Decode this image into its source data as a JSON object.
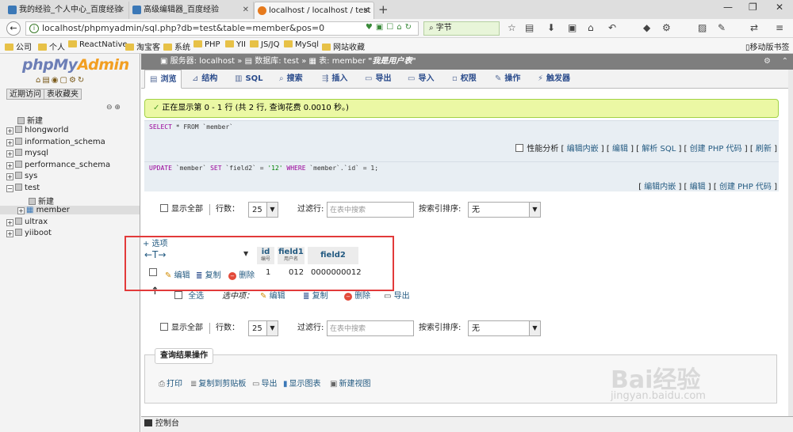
{
  "browser": {
    "tabs": [
      {
        "label": "我的经验_个人中心_百度经验"
      },
      {
        "label": "高级编辑器_百度经验"
      },
      {
        "label": "localhost / localhost / test"
      }
    ],
    "new_tab": "+",
    "url": "localhost/phpmyadmin/sql.php?db=test&table=member&pos=0",
    "search_text": "字节",
    "bookmarks": [
      "公司",
      "个人",
      "ReactNative",
      "淘宝客",
      "系统",
      "PHP",
      "YII",
      "JS/JQ",
      "MySql",
      "网站收藏"
    ],
    "mobile_bookmarks": "移动版书签"
  },
  "nav": {
    "logo_main": "phpMy",
    "logo_accent": "Admin",
    "recent_button": "近期访问",
    "favorites_button": "表收藏夹",
    "collapse": "⊖ ⊕",
    "tree": {
      "new1": "新建",
      "db1": "hlongworld",
      "db2": "information_schema",
      "db3": "mysql",
      "db4": "performance_schema",
      "db5": "sys",
      "db6": "test",
      "new2": "新建",
      "table": "member",
      "db7": "ultrax",
      "db8": "yiiboot"
    }
  },
  "breadcrumb": {
    "server_label": "服务器",
    "server": "localhost",
    "sep": "»",
    "db_label": "数据库",
    "db": "test",
    "table_label": "表",
    "table": "member",
    "title": "\"我是用户表\""
  },
  "menu": {
    "browse": "浏览",
    "structure": "结构",
    "sql": "SQL",
    "search": "搜索",
    "insert": "插入",
    "export": "导出",
    "import": "导入",
    "privileges": "权限",
    "operations": "操作",
    "triggers": "触发器"
  },
  "message": "正在显示第 0 - 1 行 (共 2 行, 查询花费 0.0010 秒。)",
  "query1": {
    "kw1": "SELECT",
    "rest": " * FROM `member`"
  },
  "query1_links": {
    "profiling": "性能分析",
    "inline": "编辑内嵌",
    "edit": "编辑",
    "explain": "解析 SQL",
    "php": "创建 PHP 代码",
    "refresh": "刷新"
  },
  "query2": {
    "kw1": "UPDATE",
    "p1": " `member` ",
    "kw2": "SET",
    "p2": " `field2` = ",
    "val": "'12'",
    "p3": " ",
    "kw3": "WHERE",
    "p4": " `member`.`id` = 1;"
  },
  "query2_links": {
    "inline": "编辑内嵌",
    "edit": "编辑",
    "php": "创建 PHP 代码"
  },
  "filter": {
    "show_all": "显示全部",
    "rows_label": "行数：",
    "rows_value": "25",
    "filter_label": "过滤行:",
    "filter_placeholder": "在表中搜索",
    "sort_label": "按索引排序:",
    "sort_value": "无"
  },
  "table": {
    "options": "+ 选项",
    "arrows": "←T→",
    "sort_caret": "▼",
    "columns": [
      {
        "name": "id",
        "sub": "编号"
      },
      {
        "name": "field1",
        "sub": "用户名"
      },
      {
        "name": "field2",
        "sub": ""
      }
    ],
    "row": {
      "edit": "编辑",
      "copy": "复制",
      "delete": "删除",
      "id": "1",
      "field1": "012",
      "field2": "0000000012"
    }
  },
  "bulk": {
    "up_arrow": "↑",
    "select_all": "全选",
    "selected": "选中项：",
    "edit": "编辑",
    "copy": "复制",
    "delete": "删除",
    "export": "导出"
  },
  "ops": {
    "legend": "查询结果操作",
    "print": "打印",
    "copy_clipboard": "复制到剪贴板",
    "export": "导出",
    "chart": "显示图表",
    "view": "新建视图"
  },
  "status": {
    "console": "控制台"
  },
  "watermark": {
    "brand": "Bai经验",
    "url": "jingyan.baidu.com"
  },
  "colors": {
    "accent_link": "#235a81",
    "success_bg": "#ebf8a4",
    "highlight_box": "#e23a3a"
  }
}
